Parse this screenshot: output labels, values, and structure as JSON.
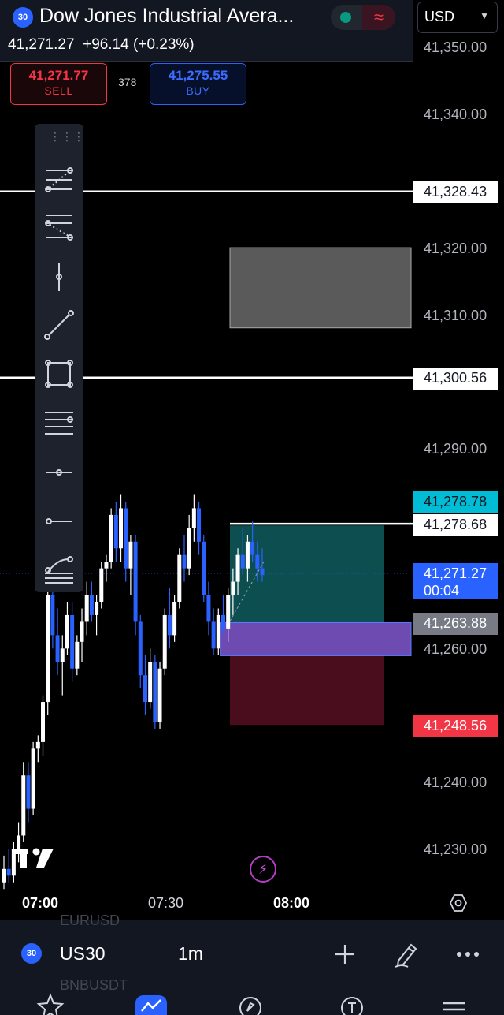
{
  "header": {
    "symbol_badge": "30",
    "title": "Dow Jones Industrial Avera...",
    "last_price": "41,271.27",
    "change": "+96.14 (+0.23%)",
    "currency": "USD"
  },
  "trade": {
    "sell_price": "41,271.77",
    "sell_label": "SELL",
    "spread": "378",
    "buy_price": "41,275.55",
    "buy_label": "BUY"
  },
  "price_scale": {
    "ticks": [
      "41,350.00",
      "41,340.00",
      "41,320.00",
      "41,310.00",
      "41,290.00",
      "41,260.00",
      "41,240.00",
      "41,230.00"
    ],
    "labels": {
      "hline_top": "41,328.43",
      "hline_mid": "41,300.56",
      "target": "41,278.78",
      "hline_low": "41,278.68",
      "current": "41,271.27",
      "countdown": "00:04",
      "entry": "41,263.88",
      "stop": "41,248.56"
    }
  },
  "time_axis": {
    "labels": [
      "07:00",
      "07:30",
      "08:00"
    ]
  },
  "bottom_bar": {
    "symbol_badge": "30",
    "symbol": "US30",
    "interval": "1m",
    "ghost_top": "EURUSD",
    "ghost_bottom": "BNBUSDT"
  },
  "icons": {
    "drawing_tools": [
      "fib-retracement-icon",
      "fib-extension-icon",
      "vertical-line-icon",
      "trend-line-icon",
      "rectangle-icon",
      "parallel-channel-icon",
      "horizontal-ray-icon",
      "ray-icon",
      "pitchfork-icon"
    ],
    "bottom": [
      "add-icon",
      "pen-icon",
      "more-icon"
    ],
    "nav": [
      "watchlist-star-icon",
      "chart-icon",
      "explore-compass-icon",
      "ideas-icon",
      "menu-icon"
    ]
  },
  "colors": {
    "background": "#000000",
    "bull": "#ffffff",
    "bear": "#2962ff",
    "sell": "#f23645",
    "buy": "#2962ff",
    "profit_zone": "#0d4f50",
    "loss_zone": "#4a0d1e",
    "entry_zone": "#6d4bb0",
    "accent_cyan": "#00bcd4"
  },
  "chart_data": {
    "type": "candlestick",
    "x": [
      "07:00",
      "07:30",
      "08:00"
    ],
    "ylim": [
      41225,
      41352
    ],
    "y_ticks": [
      41350,
      41340,
      41330,
      41320,
      41310,
      41300,
      41290,
      41280,
      41260,
      41250,
      41240,
      41230
    ],
    "horizontal_lines": [
      41328.43,
      41300.56,
      41278.68
    ],
    "current_price": 41271.27,
    "gray_box": {
      "y_from": 41308,
      "y_to": 41320
    },
    "position": {
      "target": 41278.78,
      "entry": 41263.88,
      "stop": 41248.56
    },
    "candles": [
      [
        41225,
        41229,
        41224,
        41227
      ],
      [
        41227,
        41230,
        41225,
        41226
      ],
      [
        41226,
        41231,
        41225,
        41230
      ],
      [
        41230,
        41234,
        41228,
        41232
      ],
      [
        41232,
        41243,
        41231,
        41241
      ],
      [
        41241,
        41243,
        41234,
        41236
      ],
      [
        41236,
        41246,
        41235,
        41245
      ],
      [
        41245,
        41247,
        41243,
        41246
      ],
      [
        41246,
        41253,
        41244,
        41252
      ],
      [
        41252,
        41271,
        41250,
        41268
      ],
      [
        41268,
        41270,
        41260,
        41262
      ],
      [
        41262,
        41266,
        41256,
        41258
      ],
      [
        41258,
        41262,
        41253,
        41260
      ],
      [
        41260,
        41267,
        41259,
        41265
      ],
      [
        41265,
        41267,
        41255,
        41257
      ],
      [
        41257,
        41262,
        41256,
        41261
      ],
      [
        41261,
        41266,
        41258,
        41264
      ],
      [
        41264,
        41270,
        41262,
        41268
      ],
      [
        41268,
        41270,
        41264,
        41265
      ],
      [
        41265,
        41268,
        41262,
        41267
      ],
      [
        41267,
        41273,
        41266,
        41272
      ],
      [
        41272,
        41274,
        41270,
        41273
      ],
      [
        41273,
        41281,
        41272,
        41280
      ],
      [
        41280,
        41282,
        41273,
        41275
      ],
      [
        41275,
        41283,
        41273,
        41281
      ],
      [
        41281,
        41282,
        41270,
        41272
      ],
      [
        41272,
        41277,
        41268,
        41276
      ],
      [
        41276,
        41277,
        41262,
        41264
      ],
      [
        41264,
        41265,
        41254,
        41256
      ],
      [
        41256,
        41259,
        41250,
        41252
      ],
      [
        41252,
        41260,
        41251,
        41258
      ],
      [
        41258,
        41259,
        41248,
        41249
      ],
      [
        41249,
        41258,
        41248,
        41257
      ],
      [
        41257,
        41266,
        41256,
        41265
      ],
      [
        41265,
        41269,
        41260,
        41262
      ],
      [
        41262,
        41268,
        41261,
        41267
      ],
      [
        41267,
        41275,
        41266,
        41274
      ],
      [
        41274,
        41277,
        41270,
        41272
      ],
      [
        41272,
        41280,
        41271,
        41278
      ],
      [
        41278,
        41283,
        41276,
        41281
      ],
      [
        41281,
        41282,
        41274,
        41276
      ],
      [
        41276,
        41277,
        41267,
        41268
      ],
      [
        41268,
        41270,
        41262,
        41264
      ],
      [
        41264,
        41266,
        41259,
        41260
      ],
      [
        41260,
        41266,
        41259,
        41265
      ],
      [
        41265,
        41268,
        41262,
        41263
      ],
      [
        41263,
        41269,
        41261,
        41268
      ],
      [
        41268,
        41272,
        41265,
        41270
      ],
      [
        41270,
        41275,
        41268,
        41274
      ],
      [
        41274,
        41278,
        41271,
        41272
      ],
      [
        41272,
        41277,
        41270,
        41276
      ],
      [
        41276,
        41279,
        41273,
        41274
      ],
      [
        41274,
        41276,
        41270,
        41272
      ],
      [
        41272,
        41275,
        41270,
        41271
      ]
    ]
  }
}
